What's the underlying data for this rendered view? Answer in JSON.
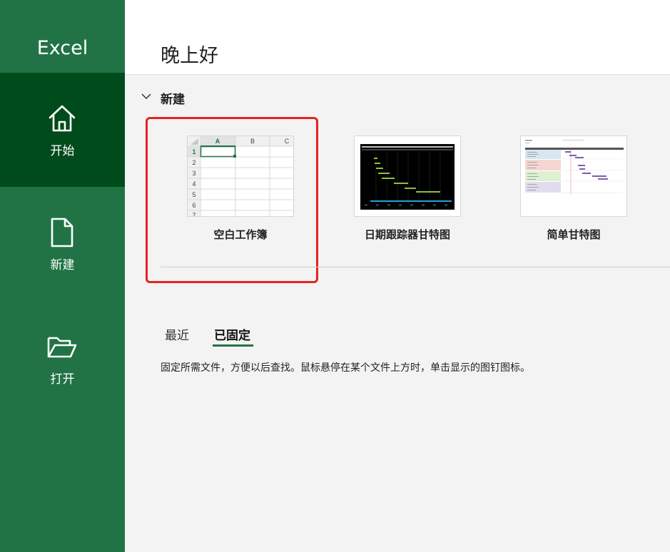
{
  "app": {
    "title": "Excel"
  },
  "sidebar": {
    "items": [
      {
        "label": "开始",
        "icon": "home-icon",
        "active": true
      },
      {
        "label": "新建",
        "icon": "new-document-icon",
        "active": false
      },
      {
        "label": "打开",
        "icon": "open-folder-icon",
        "active": false
      }
    ]
  },
  "header": {
    "greeting": "晚上好"
  },
  "new_section": {
    "title": "新建",
    "templates": [
      {
        "label": "空白工作簿"
      },
      {
        "label": "日期跟踪器甘特图"
      },
      {
        "label": "简单甘特图"
      }
    ],
    "blank_sheet": {
      "columns": [
        "A",
        "B",
        "C"
      ],
      "rows": [
        "1",
        "2",
        "3",
        "4",
        "5",
        "6",
        "7"
      ]
    }
  },
  "files": {
    "tabs": [
      {
        "label": "最近",
        "active": false
      },
      {
        "label": "已固定",
        "active": true
      }
    ],
    "pinned_hint": "固定所需文件，方便以后查找。鼠标悬停在某个文件上方时，单击显示的图钉图标。"
  },
  "colors": {
    "brand": "#217346",
    "sidebar_active": "#004b1c",
    "highlight": "#e62222"
  }
}
